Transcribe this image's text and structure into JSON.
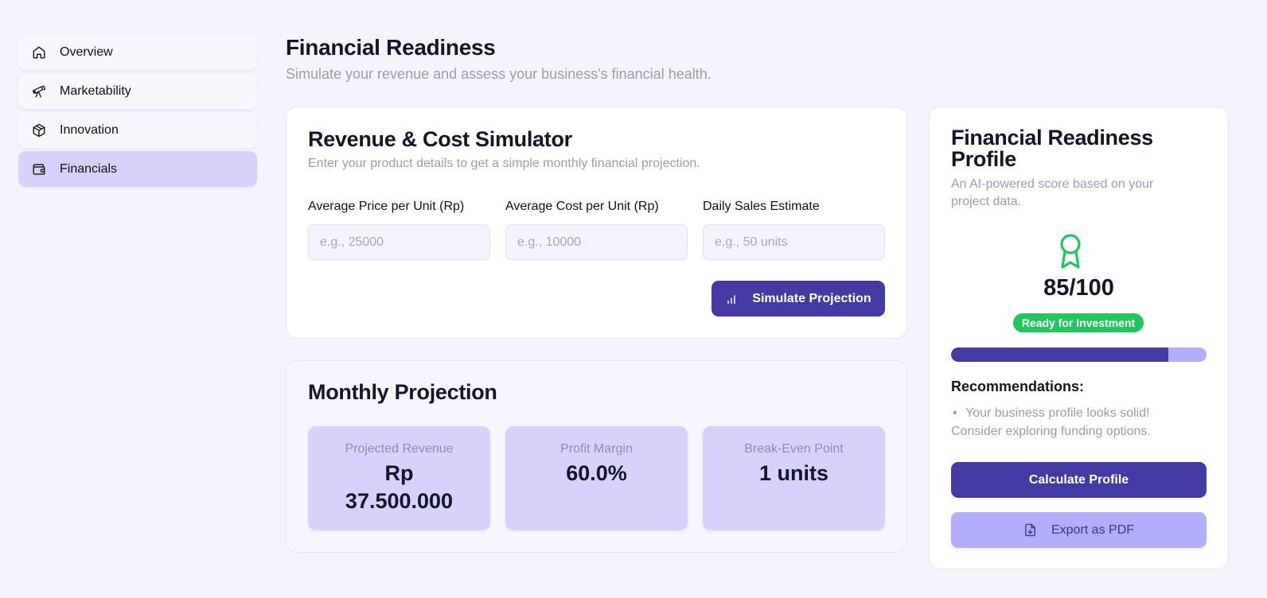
{
  "sidebar": {
    "items": [
      {
        "label": "Overview",
        "icon": "home-icon",
        "active": false
      },
      {
        "label": "Marketability",
        "icon": "telescope-icon",
        "active": false
      },
      {
        "label": "Innovation",
        "icon": "box-icon",
        "active": false
      },
      {
        "label": "Financials",
        "icon": "wallet-icon",
        "active": true
      }
    ]
  },
  "header": {
    "title": "Financial Readiness",
    "subtitle": "Simulate your revenue and assess your business's financial health."
  },
  "simulator": {
    "title": "Revenue & Cost Simulator",
    "description": "Enter your product details to get a simple monthly financial projection.",
    "fields": [
      {
        "label": "Average Price per Unit (Rp)",
        "placeholder": "e.g., 25000",
        "value": ""
      },
      {
        "label": "Average Cost per Unit (Rp)",
        "placeholder": "e.g., 10000",
        "value": ""
      },
      {
        "label": "Daily Sales Estimate",
        "placeholder": "e.g., 50 units",
        "value": ""
      }
    ],
    "button_label": "Simulate Projection"
  },
  "projection": {
    "title": "Monthly Projection",
    "stats": [
      {
        "label": "Projected Revenue",
        "value": "Rp 37.500.000"
      },
      {
        "label": "Profit Margin",
        "value": "60.0%"
      },
      {
        "label": "Break-Even Point",
        "value": "1 units"
      }
    ]
  },
  "profile": {
    "title": "Financial Readiness Profile",
    "description": "An AI-powered score based on your project data.",
    "score": "85/100",
    "score_fraction": 0.85,
    "badge": "Ready for Investment",
    "recommendations_title": "Recommendations:",
    "recommendations": [
      "Your business profile looks solid! Consider exploring funding options."
    ],
    "calculate_label": "Calculate Profile",
    "export_label": "Export as PDF"
  },
  "colors": {
    "primary": "#433ba3",
    "accent_light": "#d6d2fc",
    "progress_track": "#b3aefa",
    "success": "#22c55e",
    "background": "#f5f4fd"
  }
}
